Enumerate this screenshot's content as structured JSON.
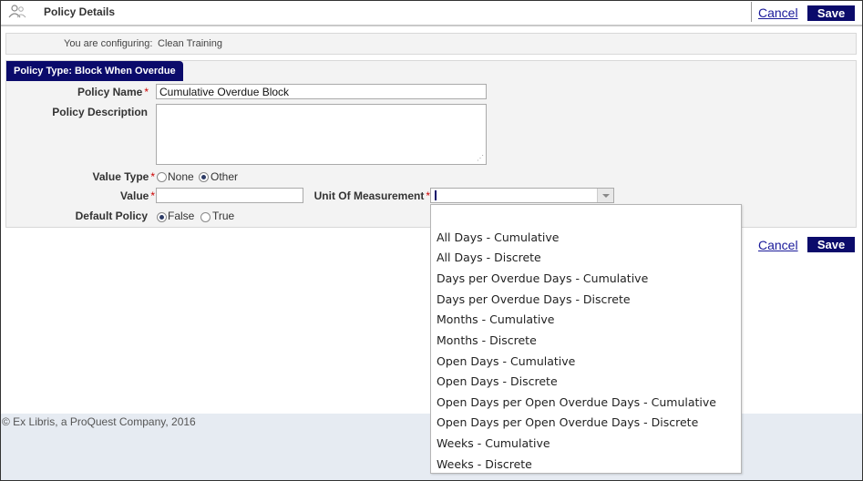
{
  "header": {
    "title": "Policy Details",
    "cancel_label": "Cancel",
    "save_label": "Save"
  },
  "configuring": {
    "label": "You are configuring:",
    "value": "Clean Training"
  },
  "panel": {
    "tab_label": "Policy Type: Block When Overdue",
    "policy_name": {
      "label": "Policy Name",
      "required": "*",
      "value": "Cumulative Overdue Block"
    },
    "policy_description": {
      "label": "Policy Description",
      "value": ""
    },
    "value_type": {
      "label": "Value Type",
      "required": "*",
      "options": [
        "None",
        "Other"
      ],
      "selected": "Other"
    },
    "value": {
      "label": "Value",
      "required": "*",
      "value": ""
    },
    "unit_of_measurement": {
      "label": "Unit Of Measurement",
      "required": "*",
      "value": ""
    },
    "default_policy": {
      "label": "Default Policy",
      "options": [
        "False",
        "True"
      ],
      "selected": "False"
    }
  },
  "actions": {
    "cancel_label": "Cancel",
    "save_label": "Save"
  },
  "footer": {
    "copyright": "© Ex Libris, a ProQuest Company, 2016"
  },
  "dropdown": {
    "items": [
      "All Days - Cumulative",
      "All Days - Discrete",
      "Days per Overdue Days - Cumulative",
      "Days per Overdue Days - Discrete",
      "Months - Cumulative",
      "Months - Discrete",
      "Open Days - Cumulative",
      "Open Days - Discrete",
      "Open Days per Open Overdue Days - Cumulative",
      "Open Days per Open Overdue Days - Discrete",
      "Weeks - Cumulative",
      "Weeks - Discrete"
    ]
  },
  "colors": {
    "accent": "#0b0b6b",
    "link": "#1a1a9a",
    "required": "#cc0000"
  },
  "icons": {
    "header": "people-icon"
  }
}
